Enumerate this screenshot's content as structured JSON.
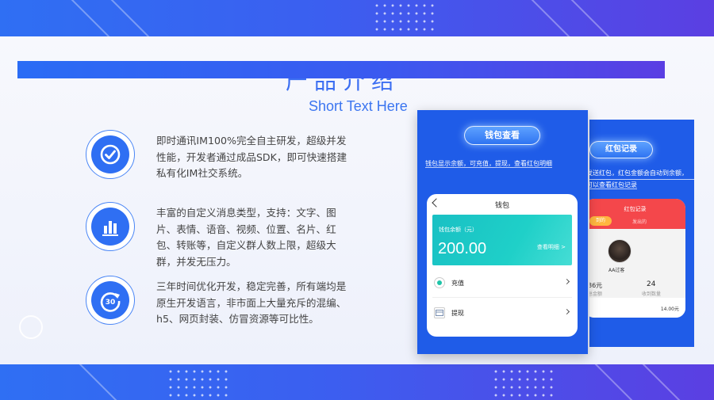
{
  "slide": {
    "title": "产品介绍",
    "subtitle": "Short Text Here"
  },
  "features": [
    {
      "icon": "check-circle-icon",
      "text": "即时通讯IM100%完全自主研发，超级并发性能，开发者通过成品SDK，即可快速搭建私有化IM社交系统。"
    },
    {
      "icon": "bar-chart-icon",
      "text": "丰富的自定义消息类型，支持：文字、图片、表情、语音、视频、位置、名片、红包、转账等，自定义群人数上限，超级大群，并发无压力。"
    },
    {
      "icon": "refresh-30-icon",
      "text": "三年时间优化开发，稳定完善，所有端均是原生开发语言，非市面上大量充斥的混编、h5、网页封装、仿冒资源等可比性。"
    }
  ],
  "phone_wallet": {
    "button": "钱包查看",
    "caption": "钱包显示余额，可充值，提现，查看红包明细",
    "nav_title": "钱包",
    "balance_label": "钱包余额（元）",
    "balance_amount": "200.00",
    "details_link": "查看明细 >",
    "rows": [
      {
        "label": "充值",
        "icon": "recharge-icon"
      },
      {
        "label": "提现",
        "icon": "withdraw-icon"
      }
    ]
  },
  "phone_redpacket": {
    "button": "红包记录",
    "caption_line1": "发送红包，红包金额会自动到余额，",
    "caption_line2": "可以查看红包记录",
    "header_title": "红包记录",
    "tab_received": "到的",
    "tab_sent": "发出的",
    "user_name": "AA过客",
    "stat_amount": "86元",
    "stat_amount_label": "总金额",
    "stat_count": "24",
    "stat_count_label": "收到数量",
    "list_amount": "14.00元"
  },
  "colors": {
    "brand_blue": "#2f6ff3",
    "brand_purple": "#5b3fe2",
    "balance_teal": "#1fd0c8",
    "redpacket_red": "#f4474b"
  }
}
